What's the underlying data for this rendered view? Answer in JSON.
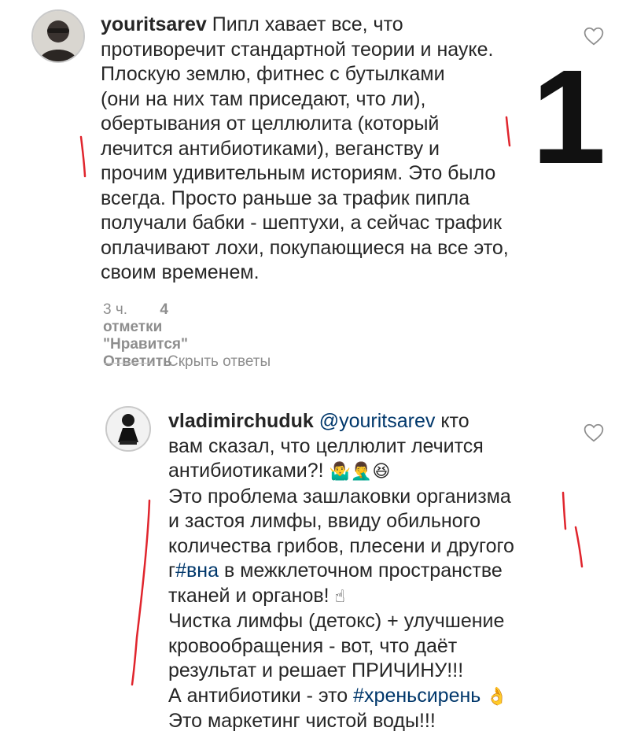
{
  "comment": {
    "username": "youritsarev",
    "text": "Пипл хавает все, что\nпротиворечит стандартной теории и науке.\nПлоскую землю, фитнес с бутылками\n(они на них там приседают, что ли),\nобертывания от целлюлита (который\nлечится антибиотиками), веганству и\nпрочим удивительным историям. Это было\nвсегда. Просто раньше за трафик пипла\nполучали бабки - шептухи, а сейчас трафик\nоплачивают лохи, покупающиеся на все это,\nсвоим временем.",
    "time": "3 ч.",
    "likes": "4 отметки \"Нравится\"",
    "reply_label": "Ответить",
    "avatar": "user-avatar-photo"
  },
  "replies_toggle": {
    "label": "Скрыть ответы"
  },
  "reply": {
    "username": "vladimirchuduk",
    "mention": "@youritsarev",
    "text_part1": " кто\nвам сказал, что целлюлит лечится\nантибиотиками?! ",
    "emoji1": "🤷‍♂️🤦‍♂️😆",
    "text_part2": "\nЭто проблема зашлаковки организма\nи застоя лимфы, ввиду обильного\nколичества грибов, плесени и другого\nг",
    "hashtag1": "#вна",
    "text_part3": " в межклеточном пространстве\nтканей и органов! ",
    "emoji2": "☝",
    "text_part4": "\nЧистка лимфы (детокс) + улучшение\nкровообращения - вот, что даёт\nрезультат и решает ПРИЧИНУ!!!\nА антибиотики - это ",
    "hashtag2": "#хреньсирень",
    "text_part5": " ",
    "emoji3": "👌",
    "text_part6": "\nЭто маркетинг чистой воды!!!",
    "avatar": "user-avatar-photo"
  },
  "annotation": {
    "number": "1",
    "mark_color": "#e0252d"
  },
  "icons": {
    "like": "heart-outline-icon"
  }
}
